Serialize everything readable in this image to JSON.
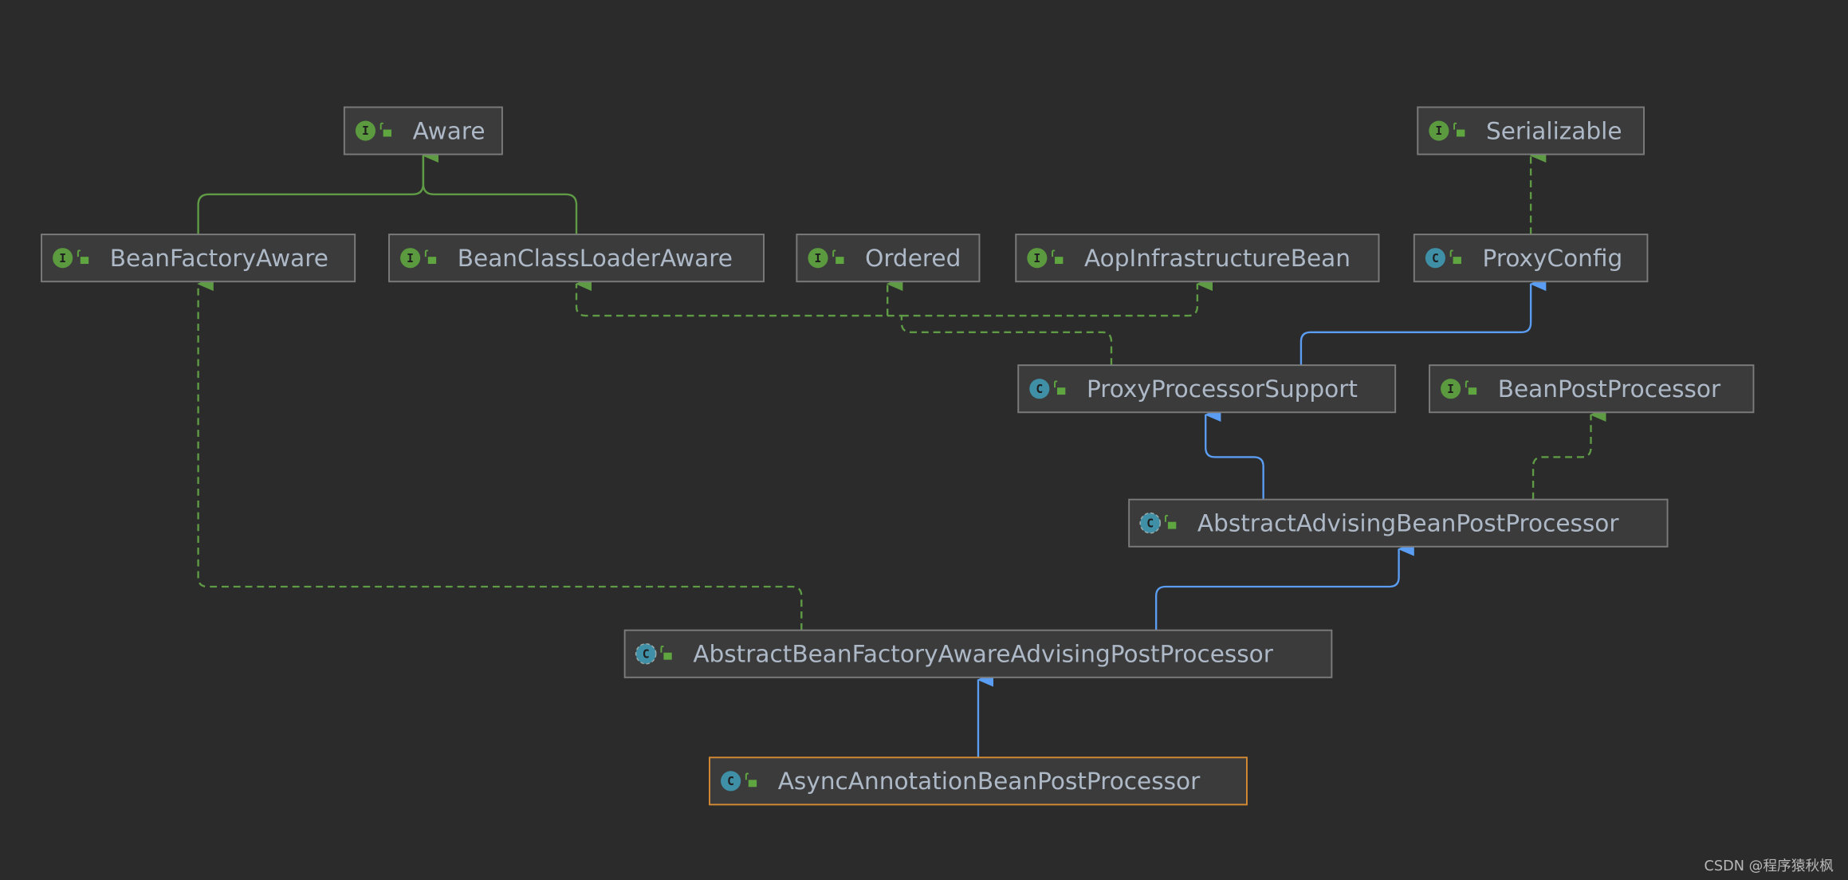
{
  "diagram": {
    "nodes": [
      {
        "id": "aware",
        "name": "Aware",
        "kind": "interface"
      },
      {
        "id": "serializable",
        "name": "Serializable",
        "kind": "interface"
      },
      {
        "id": "bfa",
        "name": "BeanFactoryAware",
        "kind": "interface"
      },
      {
        "id": "bcla",
        "name": "BeanClassLoaderAware",
        "kind": "interface"
      },
      {
        "id": "ordered",
        "name": "Ordered",
        "kind": "interface"
      },
      {
        "id": "aib",
        "name": "AopInfrastructureBean",
        "kind": "interface"
      },
      {
        "id": "pc",
        "name": "ProxyConfig",
        "kind": "class"
      },
      {
        "id": "pps",
        "name": "ProxyProcessorSupport",
        "kind": "class"
      },
      {
        "id": "bpp",
        "name": "BeanPostProcessor",
        "kind": "interface"
      },
      {
        "id": "aabpp",
        "name": "AbstractAdvisingBeanPostProcessor",
        "kind": "abstract-class"
      },
      {
        "id": "abfaapp",
        "name": "AbstractBeanFactoryAwareAdvisingPostProcessor",
        "kind": "abstract-class"
      },
      {
        "id": "async",
        "name": "AsyncAnnotationBeanPostProcessor",
        "kind": "class",
        "selected": true
      }
    ],
    "edges": [
      {
        "from": "bfa",
        "to": "aware",
        "type": "extends"
      },
      {
        "from": "bcla",
        "to": "aware",
        "type": "extends"
      },
      {
        "from": "pc",
        "to": "serializable",
        "type": "implements"
      },
      {
        "from": "pps",
        "to": "bcla",
        "type": "implements"
      },
      {
        "from": "pps",
        "to": "ordered",
        "type": "implements"
      },
      {
        "from": "pps",
        "to": "aib",
        "type": "implements"
      },
      {
        "from": "pps",
        "to": "pc",
        "type": "extends-class"
      },
      {
        "from": "aabpp",
        "to": "pps",
        "type": "extends-class"
      },
      {
        "from": "aabpp",
        "to": "bpp",
        "type": "implements"
      },
      {
        "from": "abfaapp",
        "to": "bfa",
        "type": "implements"
      },
      {
        "from": "abfaapp",
        "to": "aabpp",
        "type": "extends-class"
      },
      {
        "from": "async",
        "to": "abfaapp",
        "type": "extends-class"
      }
    ]
  },
  "colors": {
    "background": "#2b2b2b",
    "interface_edge": "#5f9a45",
    "class_edge": "#5a9df2",
    "interface_icon": "#5b9a3f",
    "class_icon": "#3f8fa6",
    "selected_border": "#d58a34"
  },
  "icons": {
    "interface": "I",
    "class": "C",
    "access": "unlocked-public-icon"
  },
  "watermark": "CSDN @程序猿秋枫"
}
